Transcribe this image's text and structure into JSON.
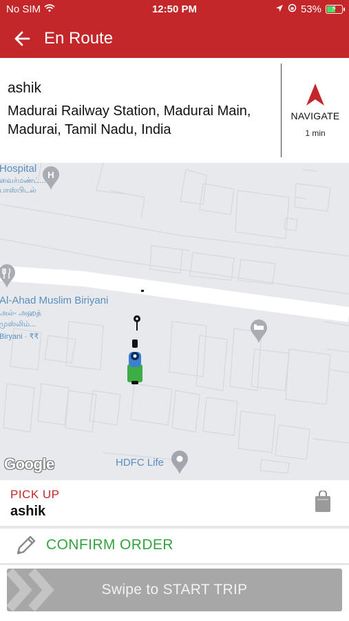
{
  "status_bar": {
    "carrier": "No SIM",
    "time": "12:50 PM",
    "battery": "53%",
    "battery_level": 0.53
  },
  "header": {
    "title": "En Route",
    "back_icon": "arrow-left-icon",
    "color": "#c3272a"
  },
  "destination": {
    "name": "ashik",
    "address": "Madurai Railway Station, Madurai Main, Madurai, Tamil Nadu, India",
    "navigate_label": "NAVIGATE",
    "eta": "1 min"
  },
  "map": {
    "labels": {
      "hospital": "Hospital",
      "hospital_tamil": "வைர்மண்ட்...",
      "hospital_tamil2": "பாஸ்பிடல்",
      "restaurant": "Al-Ahad Muslim Biriyani",
      "restaurant_tamil": "அல்- அஹத்",
      "restaurant_tamil2": "முஸ்லிம்...",
      "restaurant_sub": "Biryani · ₹₹",
      "poi": "HDFC Life"
    },
    "attribution": "Google"
  },
  "pickup": {
    "label": "PICK UP",
    "name": "ashik"
  },
  "order": {
    "confirm_label": "CONFIRM ORDER",
    "color": "#34a33f"
  },
  "swipe": {
    "label": "Swipe to START TRIP"
  }
}
